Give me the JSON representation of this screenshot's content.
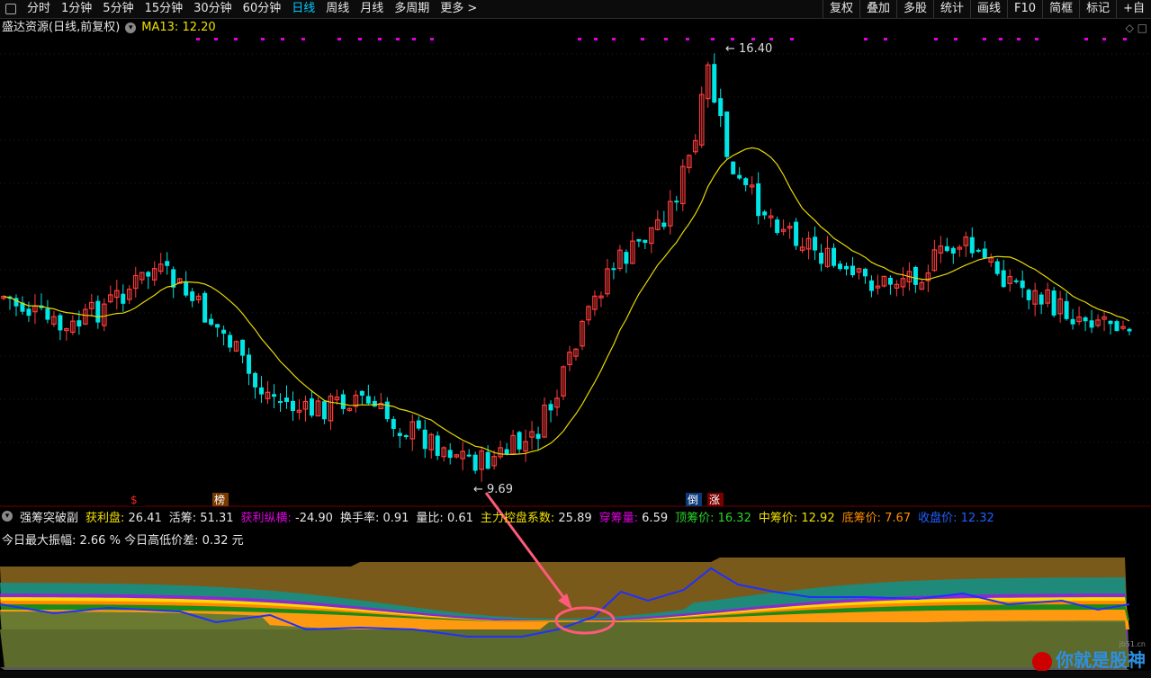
{
  "toolbar": {
    "periods": [
      "分时",
      "1分钟",
      "5分钟",
      "15分钟",
      "30分钟",
      "60分钟",
      "日线",
      "周线",
      "月线",
      "多周期",
      "更多 >"
    ],
    "active_period": "日线",
    "right_buttons": [
      "复权",
      "叠加",
      "多股",
      "统计",
      "画线",
      "F10",
      "简框",
      "标记",
      "+自"
    ]
  },
  "main_chart": {
    "title": "盛达资源(日线,前复权)",
    "ma_label": "MA13: 12.20",
    "high_label": "16.40",
    "low_label": "9.69",
    "markers": [
      "$",
      "榜",
      "倒",
      "涨"
    ],
    "colors": {
      "up": "#ff3c3c",
      "down": "#00e5e5",
      "ma": "#e8d800",
      "marks": "#e000e0"
    }
  },
  "indicator": {
    "name": "强筹突破副",
    "items": [
      {
        "label": "获利盘:",
        "value": "26.41",
        "color": "#f0e000"
      },
      {
        "label": "活筹:",
        "value": "51.31",
        "color": "#e6e6e6"
      },
      {
        "label": "获利纵横:",
        "value": "-24.90",
        "color": "#e000e0"
      },
      {
        "label": "换手率:",
        "value": "0.91",
        "color": "#e6e6e6"
      },
      {
        "label": "量比:",
        "value": "0.61",
        "color": "#e6e6e6"
      },
      {
        "label": "主力控盘系数:",
        "value": "25.89",
        "color": "#f0e000"
      },
      {
        "label": "穿筹量:",
        "value": "6.59",
        "color": "#e000e0"
      },
      {
        "label": "顶筹价:",
        "value": "16.32",
        "color": "#2ad52a"
      },
      {
        "label": "中筹价:",
        "value": "12.92",
        "color": "#f0e000"
      },
      {
        "label": "底筹价:",
        "value": "7.67",
        "color": "#ff8c00"
      },
      {
        "label": "收盘价:",
        "value": "12.32",
        "color": "#2060ff"
      }
    ],
    "row2": "今日最大振幅: 2.66 %  今日高低价差: 0.32 元"
  },
  "watermark": {
    "text": "你就是股神",
    "site": "jb51.cn"
  }
}
